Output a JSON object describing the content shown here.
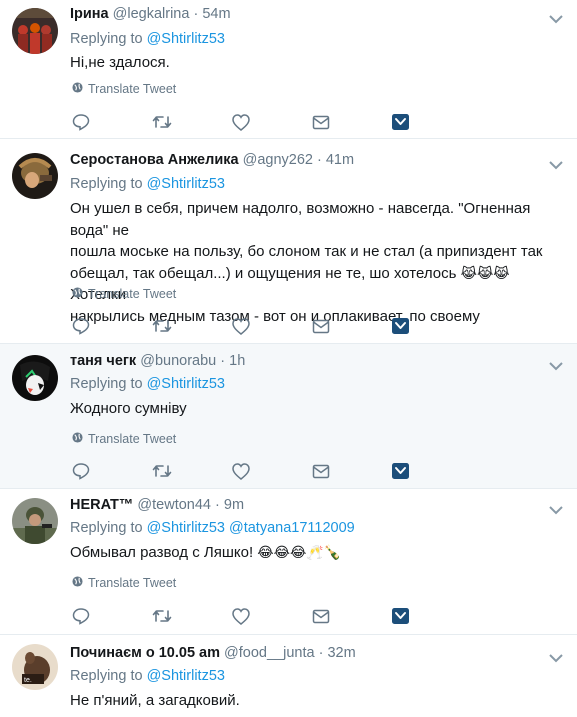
{
  "tweets": [
    {
      "name": "Ірина",
      "handle": "@legkalrina",
      "time": "54m",
      "replying_prefix": "Replying to",
      "replying_to": [
        "@Shtirlitz53"
      ],
      "text": "Ні,не здалося.",
      "translate": "Translate Tweet",
      "highlighted": false
    },
    {
      "name": "Серостанова Анжелика",
      "handle": "@agny262",
      "time": "41m",
      "replying_prefix": "Replying to",
      "replying_to": [
        "@Shtirlitz53"
      ],
      "text_lines": [
        "Он ушел в себя, причем надолго, возможно - навсегда. \"Огненная вода\" не",
        "пошла моське на пользу, бо слоном так и не стал (а припиздент так",
        "обещал, так обещал...) и ощущения не те, шо хотелось",
        "накрылись медным тазом - вот он и оплакивает..по своему"
      ],
      "emoji_inline": "😹😹😹",
      "text_after_emoji": "Хотелки",
      "translate": "Translate Tweet",
      "highlighted": false
    },
    {
      "name": "таня чегк",
      "handle": "@bunorabu",
      "time": "1h",
      "replying_prefix": "Replying to",
      "replying_to": [
        "@Shtirlitz53"
      ],
      "text": "Жодного сумніву",
      "translate": "Translate Tweet",
      "highlighted": true
    },
    {
      "name": "HERAT™",
      "handle": "@tewton44",
      "time": "9m",
      "replying_prefix": "Replying to",
      "replying_to": [
        "@Shtirlitz53",
        "@tatyana17112009"
      ],
      "text": "Обмывал развод с Ляшко!",
      "emoji": "😂😂😂🥂🍾",
      "translate": "Translate Tweet",
      "highlighted": false
    },
    {
      "name": "Починаєм о 10.05 am",
      "handle": "@food__junta",
      "time": "32m",
      "replying_prefix": "Replying to",
      "replying_to": [
        "@Shtirlitz53"
      ],
      "text": "Не п'яний, а загадковий.",
      "highlighted": false
    }
  ],
  "icons": [
    "globe-icon",
    "reply-icon",
    "retweet-icon",
    "like-icon",
    "dm-icon",
    "activity-icon",
    "caret-down-icon"
  ],
  "colors": {
    "link": "#1b95e0",
    "muted": "#657786",
    "text": "#14171a",
    "divider": "#e6ecf0",
    "highlight_bg": "#f5f8fa"
  }
}
